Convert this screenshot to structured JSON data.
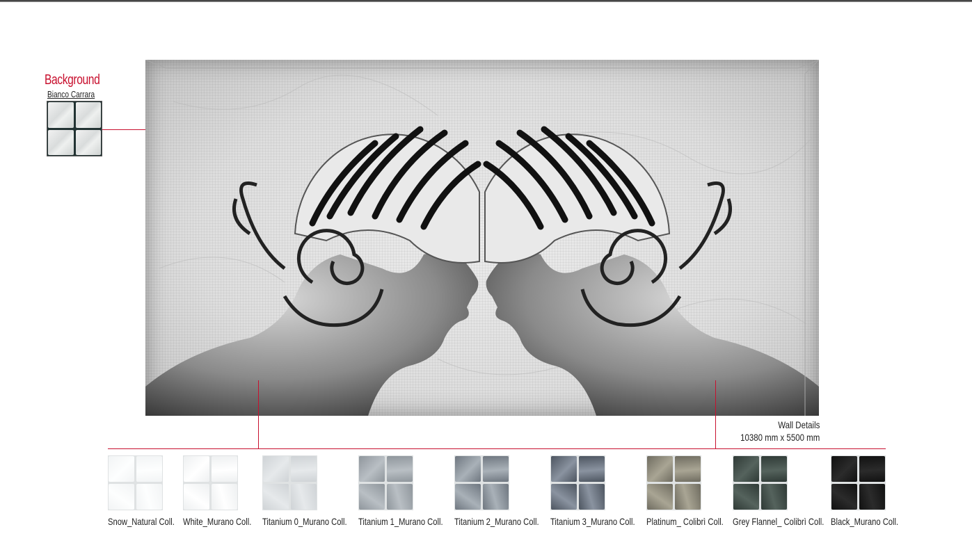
{
  "background": {
    "title": "Background",
    "name": "Bianco Carrara"
  },
  "wall": {
    "title": "Wall Details",
    "size": "10380 mm x 5500 mm"
  },
  "palette": [
    {
      "label": "Snow_Natural Coll.",
      "color": "#f2f4f5",
      "color2": "#fdfefe"
    },
    {
      "label": "White_Murano Coll.",
      "color": "#eef0f1",
      "color2": "#ffffff"
    },
    {
      "label": "Titanium 0_Murano Coll.",
      "color": "#cfd3d6",
      "color2": "#e6e9eb"
    },
    {
      "label": "Titanium 1_Murano Coll.",
      "color": "#8f969c",
      "color2": "#b9bfc4"
    },
    {
      "label": "Titanium 2_Murano Coll.",
      "color": "#6f7780",
      "color2": "#a9b1b8"
    },
    {
      "label": "Titanium 3_Murano Coll.",
      "color": "#4d5560",
      "color2": "#8a93a0"
    },
    {
      "label": "Platinum_ Colibrì Coll.",
      "color": "#6f6c60",
      "color2": "#a9a594"
    },
    {
      "label": "Grey Flannel_ Colibrì Coll.",
      "color": "#2f3a36",
      "color2": "#55635d"
    },
    {
      "label": "Black_Murano Coll.",
      "color": "#111111",
      "color2": "#2b2b2b"
    }
  ],
  "colors": {
    "accent": "#c8102e"
  }
}
